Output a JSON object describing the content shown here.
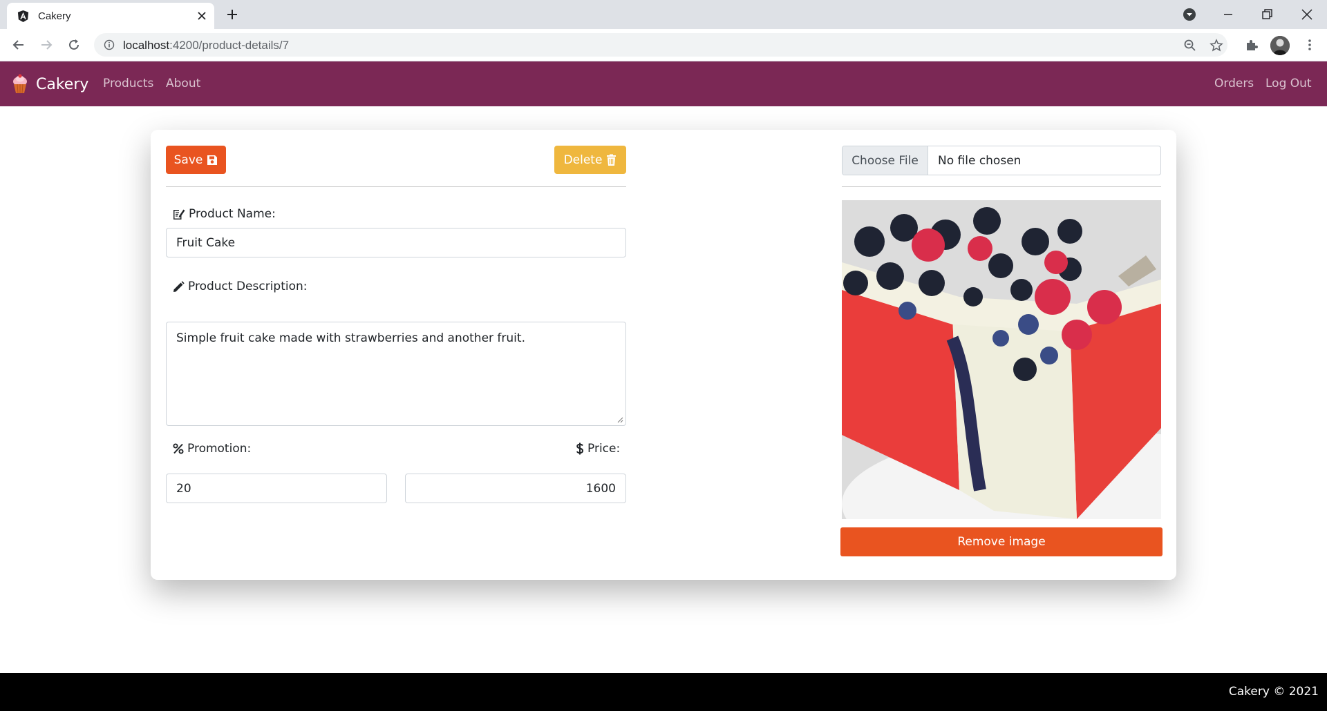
{
  "browser": {
    "tab_title": "Cakery",
    "url_host": "localhost",
    "url_rest": ":4200/product-details/7"
  },
  "navbar": {
    "brand": "Cakery",
    "links_left": [
      "Products",
      "About"
    ],
    "links_right": [
      "Orders",
      "Log Out"
    ]
  },
  "form": {
    "save_label": "Save",
    "delete_label": "Delete",
    "name_label": "Product Name:",
    "name_value": "Fruit Cake",
    "description_label": "Product Description:",
    "description_value": "Simple fruit cake made with strawberries and another fruit.",
    "promotion_label": "Promotion:",
    "promotion_value": "20",
    "price_label": "Price:",
    "price_value": "1600"
  },
  "image_panel": {
    "choose_file_label": "Choose File",
    "file_status": "No file chosen",
    "remove_label": "Remove image"
  },
  "footer": {
    "text": "Cakery © 2021"
  },
  "colors": {
    "navbar": "#7b2855",
    "primary": "#e95420",
    "warning": "#efb73e",
    "footer": "#000000"
  },
  "icons": {
    "save": "floppy-disk-icon",
    "delete": "trash-icon",
    "name": "edit-document-icon",
    "description": "pencil-icon",
    "promotion": "percent-icon",
    "price": "dollar-icon"
  }
}
